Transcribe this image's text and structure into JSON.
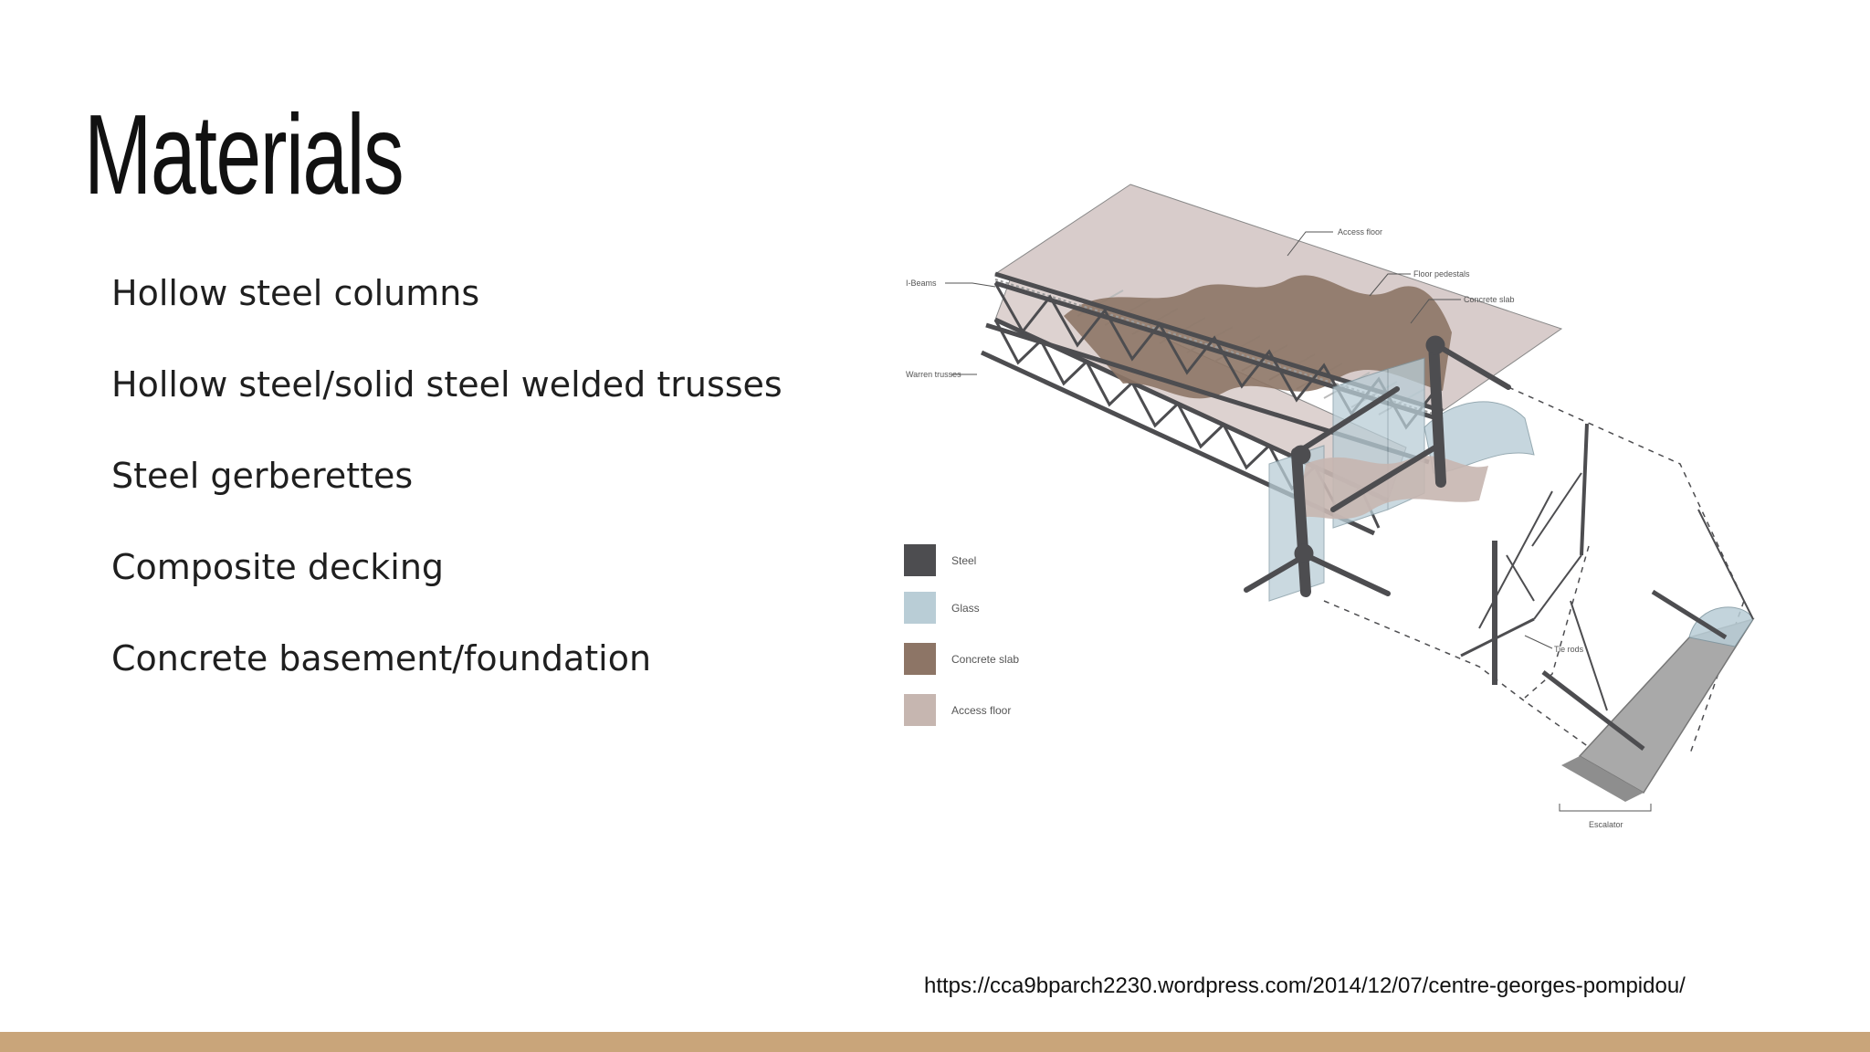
{
  "slide": {
    "title": "Materials",
    "bullets": [
      "Hollow steel columns",
      "Hollow steel/solid steel welded trusses",
      "Steel gerberettes",
      "Composite decking",
      "Concrete basement/foundation"
    ],
    "source_url": "https://cca9bparch2230.wordpress.com/2014/12/07/centre-georges-pompidou/"
  },
  "diagram": {
    "labels": {
      "access_floor": "Access floor",
      "floor_pedestals": "Floor pedestals",
      "concrete_slab": "Concrete slab",
      "i_beams": "I-Beams",
      "warren_trusses": "Warren trusses",
      "tie_rods": "Tie rods",
      "escalator": "Escalator"
    },
    "legend": [
      {
        "label": "Steel",
        "color": "#4d4d50"
      },
      {
        "label": "Glass",
        "color": "#b9cdd6"
      },
      {
        "label": "Concrete slab",
        "color": "#8d7566"
      },
      {
        "label": "Access floor",
        "color": "#c6b6b0"
      }
    ]
  },
  "colors": {
    "footer_bar": "#c9a57a",
    "steel": "#4d4d50",
    "glass": "#b9cdd6",
    "concrete": "#8d7566",
    "access_floor": "#d8cccb"
  }
}
